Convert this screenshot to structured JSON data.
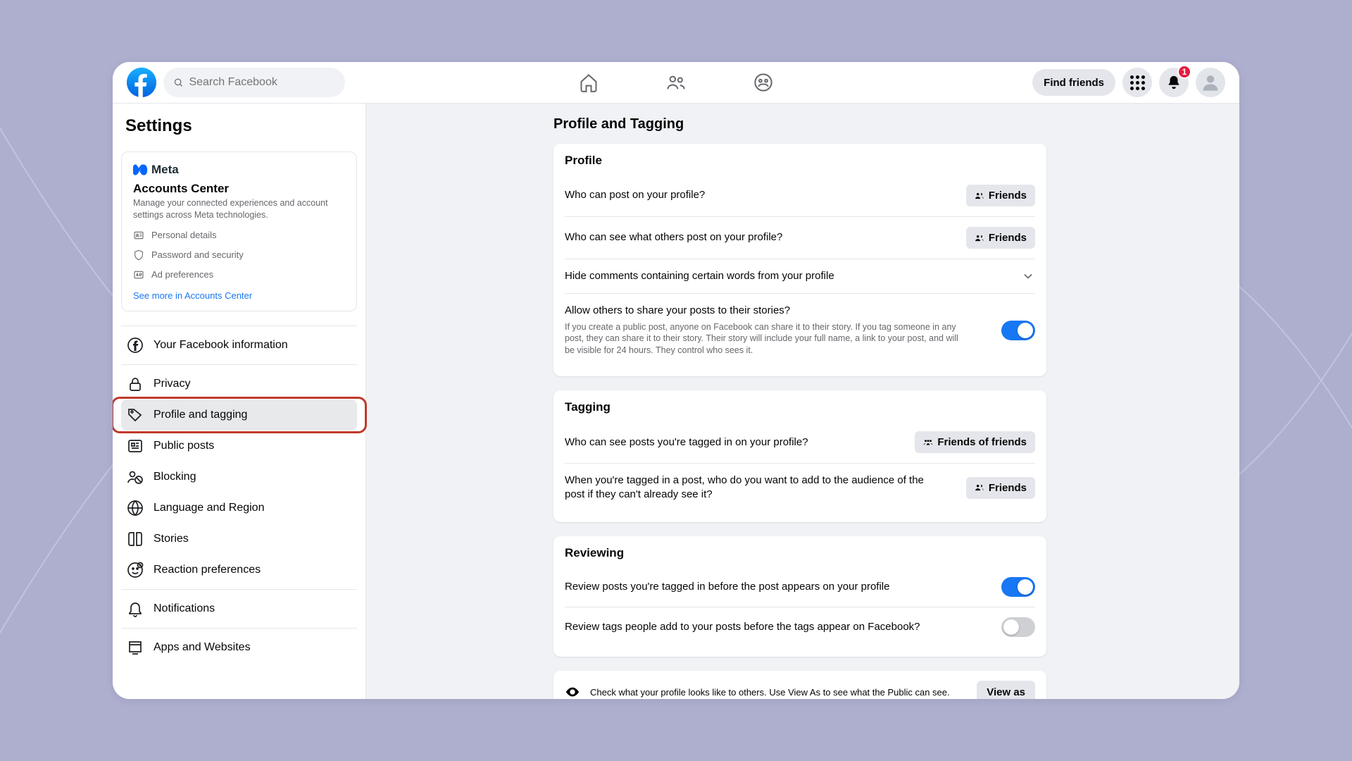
{
  "header": {
    "search_placeholder": "Search Facebook",
    "find_friends": "Find friends",
    "notification_count": "1"
  },
  "sidebar": {
    "title": "Settings",
    "accounts_center": {
      "brand": "Meta",
      "title": "Accounts Center",
      "desc": "Manage your connected experiences and account settings across Meta technologies.",
      "items": [
        {
          "label": "Personal details"
        },
        {
          "label": "Password and security"
        },
        {
          "label": "Ad preferences"
        }
      ],
      "more_link": "See more in Accounts Center"
    },
    "nav": [
      {
        "label": "Your Facebook information",
        "icon": "fb"
      },
      {
        "label": "Privacy",
        "icon": "lock"
      },
      {
        "label": "Profile and tagging",
        "icon": "tag",
        "active": true
      },
      {
        "label": "Public posts",
        "icon": "feed"
      },
      {
        "label": "Blocking",
        "icon": "block"
      },
      {
        "label": "Language and Region",
        "icon": "globe"
      },
      {
        "label": "Stories",
        "icon": "book"
      },
      {
        "label": "Reaction preferences",
        "icon": "reaction"
      },
      {
        "label": "Notifications",
        "icon": "bell"
      },
      {
        "label": "Apps and Websites",
        "icon": "apps"
      }
    ]
  },
  "main": {
    "title": "Profile and Tagging",
    "sections": {
      "profile": {
        "heading": "Profile",
        "rows": {
          "post_on_profile": {
            "label": "Who can post on your profile?",
            "value": "Friends"
          },
          "see_others_post": {
            "label": "Who can see what others post on your profile?",
            "value": "Friends"
          },
          "hide_comments": {
            "label": "Hide comments containing certain words from your profile"
          },
          "allow_share": {
            "label": "Allow others to share your posts to their stories?",
            "sub": "If you create a public post, anyone on Facebook can share it to their story. If you tag someone in any post, they can share it to their story. Their story will include your full name, a link to your post, and will be visible for 24 hours. They control who sees it.",
            "toggle": true
          }
        }
      },
      "tagging": {
        "heading": "Tagging",
        "rows": {
          "see_tagged": {
            "label": "Who can see posts you're tagged in on your profile?",
            "value": "Friends of friends"
          },
          "add_audience": {
            "label": "When you're tagged in a post, who do you want to add to the audience of the post if they can't already see it?",
            "value": "Friends"
          }
        }
      },
      "reviewing": {
        "heading": "Reviewing",
        "rows": {
          "review_posts": {
            "label": "Review posts you're tagged in before the post appears on your profile",
            "toggle": true
          },
          "review_tags": {
            "label": "Review tags people add to your posts before the tags appear on Facebook?",
            "toggle": false
          }
        }
      },
      "viewas": {
        "text": "Check what your profile looks like to others. Use View As to see what the Public can see.",
        "button": "View as"
      }
    }
  }
}
